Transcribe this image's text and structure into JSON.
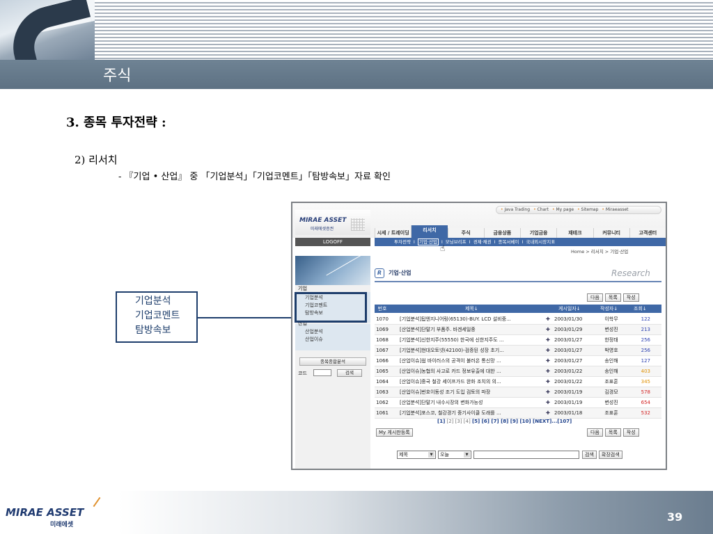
{
  "header": {
    "title": "주식"
  },
  "slide": {
    "section_title": "3. 종목 투자전략 :",
    "subtitle": "2) 리서치",
    "description": "- 『기업 • 산업』 중 「기업분석」「기업코멘트」「탐방속보」자료 확인",
    "callout": [
      "기업분석",
      "기업코멘트",
      "탐방속보"
    ],
    "page_number": "39"
  },
  "footer": {
    "logo_text": "MIRAE ASSET",
    "logo_sub": "미래에셋"
  },
  "screenshot": {
    "logo": {
      "text": "MIRAE ASSET",
      "sub": "미래에셋증권"
    },
    "top_links": [
      "Java Trading",
      "Chart",
      "My page",
      "Sitemap",
      "Miraeasset"
    ],
    "nav": [
      "시세 / 트레이딩",
      "리서치",
      "주식",
      "금융상품",
      "기업금융",
      "재테크",
      "커뮤니티",
      "고객센터"
    ],
    "subnav": [
      "투자전략",
      "I",
      "기업·산업",
      "I",
      "모닝브리프",
      "I",
      "경제·채권",
      "I",
      "종목서베이",
      "I",
      "국내외시장지표"
    ],
    "logoff": "LOGOFF",
    "breadcrumb": "Home > 리서치 > 기업·산업",
    "left": {
      "group1": "기업",
      "group1_items": [
        "기업분석",
        "기업코멘트",
        "탐방속보"
      ],
      "group2": "산업",
      "group2_items": [
        "산업분석",
        "산업이슈"
      ],
      "screen_button": "종목종합분석",
      "code_label": "코드",
      "search_button": "검색"
    },
    "main": {
      "title_icon": "R",
      "title": "기업·산업",
      "watermark": "Research",
      "buttons_top": [
        "다음",
        "목록",
        "작성"
      ],
      "columns": [
        "번호",
        "제목↓",
        "게시일자↓",
        "작성자↓",
        "조회↓"
      ],
      "rows": [
        {
          "num": "1070",
          "title": "[기업분석]탑엔지니어링(65130)-BUY. LCD 설비중...",
          "date": "2003/01/30",
          "author": "이학무",
          "views": "122",
          "vcolor": "#2a3fb0"
        },
        {
          "num": "1069",
          "title": "[산업분석]단말기 부품주. 바겐세일중",
          "date": "2003/01/29",
          "author": "변성진",
          "views": "213",
          "vcolor": "#2a3fb0"
        },
        {
          "num": "1068",
          "title": "[기업분석]신한지주(55550) 한국에 신한지주도 ...",
          "date": "2003/01/27",
          "author": "한정태",
          "views": "256",
          "vcolor": "#2a3fb0"
        },
        {
          "num": "1067",
          "title": "[기업분석]현대오토넷(42100)-검증된 성장 초기...",
          "date": "2003/01/27",
          "author": "박영호",
          "views": "256",
          "vcolor": "#2a3fb0"
        },
        {
          "num": "1066",
          "title": "[산업이슈]웜 바이러스의 공격이 불러온 통신망 ...",
          "date": "2003/01/27",
          "author": "송인해",
          "views": "127",
          "vcolor": "#2a3fb0"
        },
        {
          "num": "1065",
          "title": "[산업이슈]농협의 사고로 카드 정보유출에 대한 ...",
          "date": "2003/01/22",
          "author": "송인해",
          "views": "403",
          "vcolor": "#e09000"
        },
        {
          "num": "1064",
          "title": "[산업이슈]중국 철강 세이프가드 완화 조치의 의...",
          "date": "2003/01/22",
          "author": "조표훈",
          "views": "345",
          "vcolor": "#e09000"
        },
        {
          "num": "1063",
          "title": "[산업이슈]번호이동성 조기 도입 검토의 파장",
          "date": "2003/01/19",
          "author": "김경모",
          "views": "578",
          "vcolor": "#d22020"
        },
        {
          "num": "1062",
          "title": "[산업분석]단말기 내수시장의 변화가능성",
          "date": "2003/01/19",
          "author": "변성진",
          "views": "654",
          "vcolor": "#d22020"
        },
        {
          "num": "1061",
          "title": "[기업분석]포스코, 철강경기 중기사이클 도래를 ...",
          "date": "2003/01/18",
          "author": "조표훈",
          "views": "532",
          "vcolor": "#d22020"
        }
      ],
      "pager": {
        "current": "[1]",
        "pages": "[2] [3] [4]",
        "pages2": "[5] [6] [7] [8] [9] [10] [NEXT]...[107]"
      },
      "my_board": "My 게시판등록",
      "buttons_bottom": [
        "다음",
        "목록",
        "작성"
      ],
      "search": {
        "field": "제목",
        "period": "오늘",
        "button": "검색",
        "advanced": "확장검색"
      }
    }
  }
}
